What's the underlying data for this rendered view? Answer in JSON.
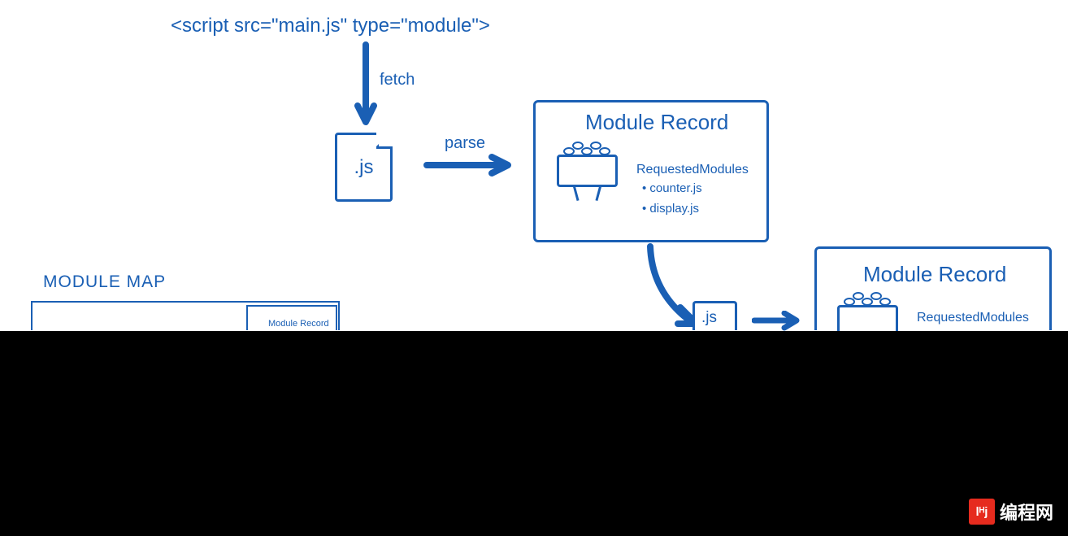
{
  "scriptTag": "<script src=\"main.js\" type=\"module\">",
  "fetchLabel": "fetch",
  "parseLabel": "parse",
  "jsExtension": ".js",
  "jsExtension2": ".js",
  "moduleRecord": {
    "title": "Module Record",
    "requestedModulesLabel": "RequestedModules",
    "modules": [
      "counter.js",
      "display.js"
    ]
  },
  "moduleMapLabel": "MODULE MAP",
  "smallModuleRecord": "Module Record",
  "moduleRecord2": {
    "title": "Module Record",
    "requestedModulesLabel": "RequestedModules"
  },
  "watermark": {
    "icon": "lᴴj",
    "text": "编程网"
  }
}
